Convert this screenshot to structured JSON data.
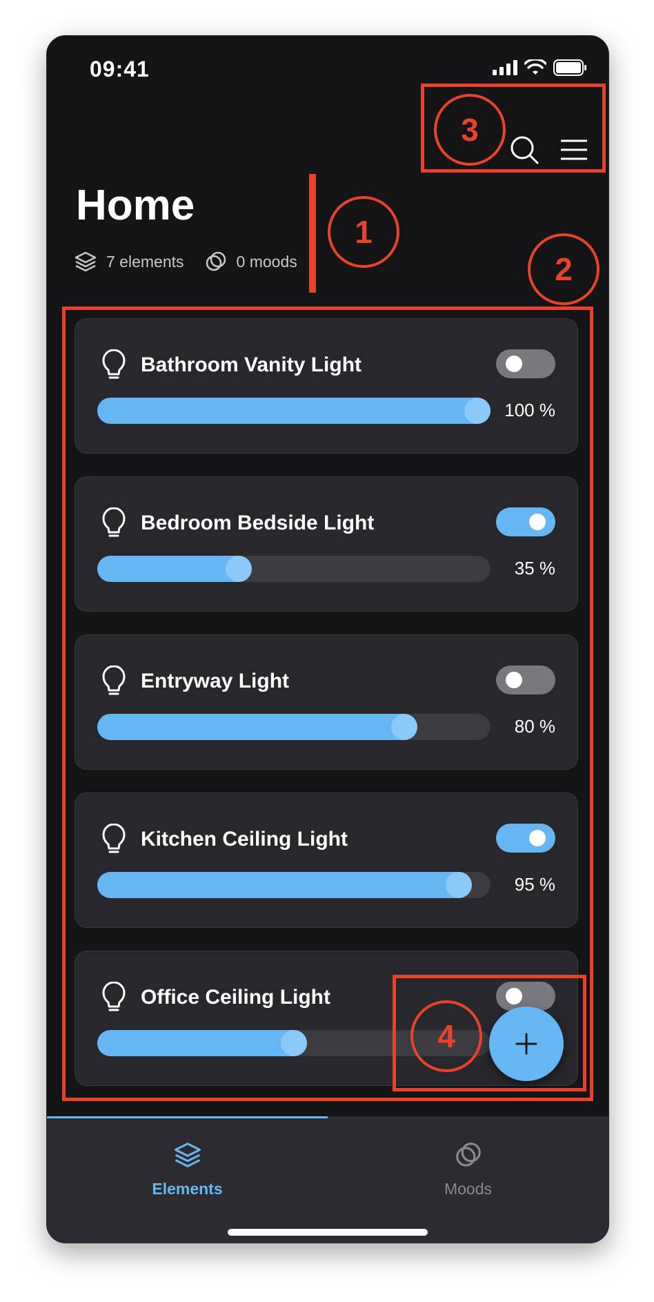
{
  "status_bar": {
    "time": "09:41"
  },
  "header": {
    "title": "Home",
    "elements_count": "7 elements",
    "moods_count": "0 moods"
  },
  "lights": [
    {
      "name": "Bathroom Vanity Light",
      "on": false,
      "brightness": 100,
      "brightness_label": "100 %"
    },
    {
      "name": "Bedroom Bedside Light",
      "on": true,
      "brightness": 35,
      "brightness_label": "35 %"
    },
    {
      "name": "Entryway Light",
      "on": false,
      "brightness": 80,
      "brightness_label": "80 %"
    },
    {
      "name": "Kitchen Ceiling Light",
      "on": true,
      "brightness": 95,
      "brightness_label": "95 %"
    },
    {
      "name": "Office Ceiling Light",
      "on": false,
      "brightness": 50,
      "brightness_label": ""
    }
  ],
  "tabs": [
    {
      "label": "Elements",
      "active": true
    },
    {
      "label": "Moods",
      "active": false
    }
  ],
  "annotations": [
    "1",
    "2",
    "3",
    "4"
  ],
  "colors": {
    "accent": "#67b6f4",
    "annotation": "#e8432a",
    "background": "#141316",
    "card": "#28272b"
  },
  "icons": {
    "search": "search-icon",
    "menu": "menu-icon",
    "elements": "layers-icon",
    "moods": "moods-icon",
    "light": "lightbulb-icon",
    "add": "plus-icon"
  }
}
